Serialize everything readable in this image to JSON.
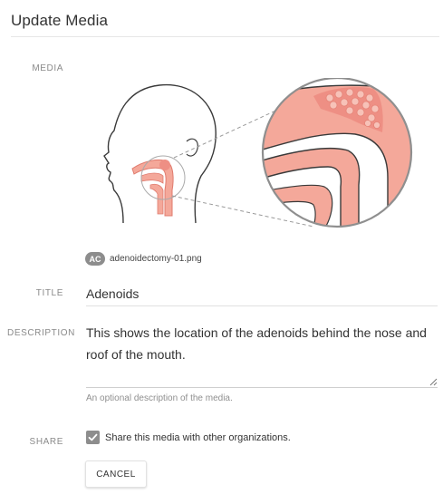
{
  "header": {
    "title": "Update Media"
  },
  "labels": {
    "media": "MEDIA",
    "title": "TITLE",
    "description": "DESCRIPTION",
    "share": "SHARE"
  },
  "media": {
    "illustration_icon": "adenoids-anatomy-illustration",
    "file_badge": "AC",
    "file_name": "adenoidectomy-01.png"
  },
  "fields": {
    "title_value": "Adenoids",
    "description_value": "This shows the location of the adenoids behind the nose and roof of the mouth.",
    "description_help": "An optional description of the media."
  },
  "share": {
    "checked": true,
    "label": "Share this media with other organizations."
  },
  "actions": {
    "cancel_label": "CANCEL"
  },
  "colors": {
    "tissue": "#f4a89a",
    "tissue_dark": "#e07b6e",
    "outline": "#3a3a3a",
    "checkbox": "#8d8d8d"
  }
}
